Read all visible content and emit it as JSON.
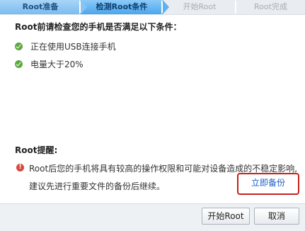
{
  "stepper": {
    "steps": [
      {
        "label": "Root准备",
        "state": "done"
      },
      {
        "label": "检测Root条件",
        "state": "active"
      },
      {
        "label": "开始Root",
        "state": "pending"
      },
      {
        "label": "Root完成",
        "state": "pending"
      }
    ]
  },
  "check": {
    "heading": "Root前请检查您的手机是否满足以下条件：",
    "conditions": [
      {
        "text": "正在使用USB连接手机",
        "icon": "check-circle-icon",
        "status": "ok"
      },
      {
        "text": "电量大于20%",
        "icon": "check-circle-icon",
        "status": "ok"
      }
    ]
  },
  "warning": {
    "title": "Root提醒:",
    "line1": "Root后您的手机将具有较高的操作权限和可能对设备造成的不稳定影响,",
    "line2": "建议先进行重要文件的备份后继续。",
    "icon": "warning-circle-icon",
    "backup_link": "立即备份"
  },
  "buttons": {
    "start": "开始Root",
    "cancel": "取消"
  },
  "colors": {
    "step_done": "#7bbcf0",
    "step_active": "#4aa6ee",
    "ok_green": "#5aa83f",
    "warn_red": "#d9473c",
    "link_blue": "#1c5dc4",
    "highlight_red": "#c8201b"
  }
}
